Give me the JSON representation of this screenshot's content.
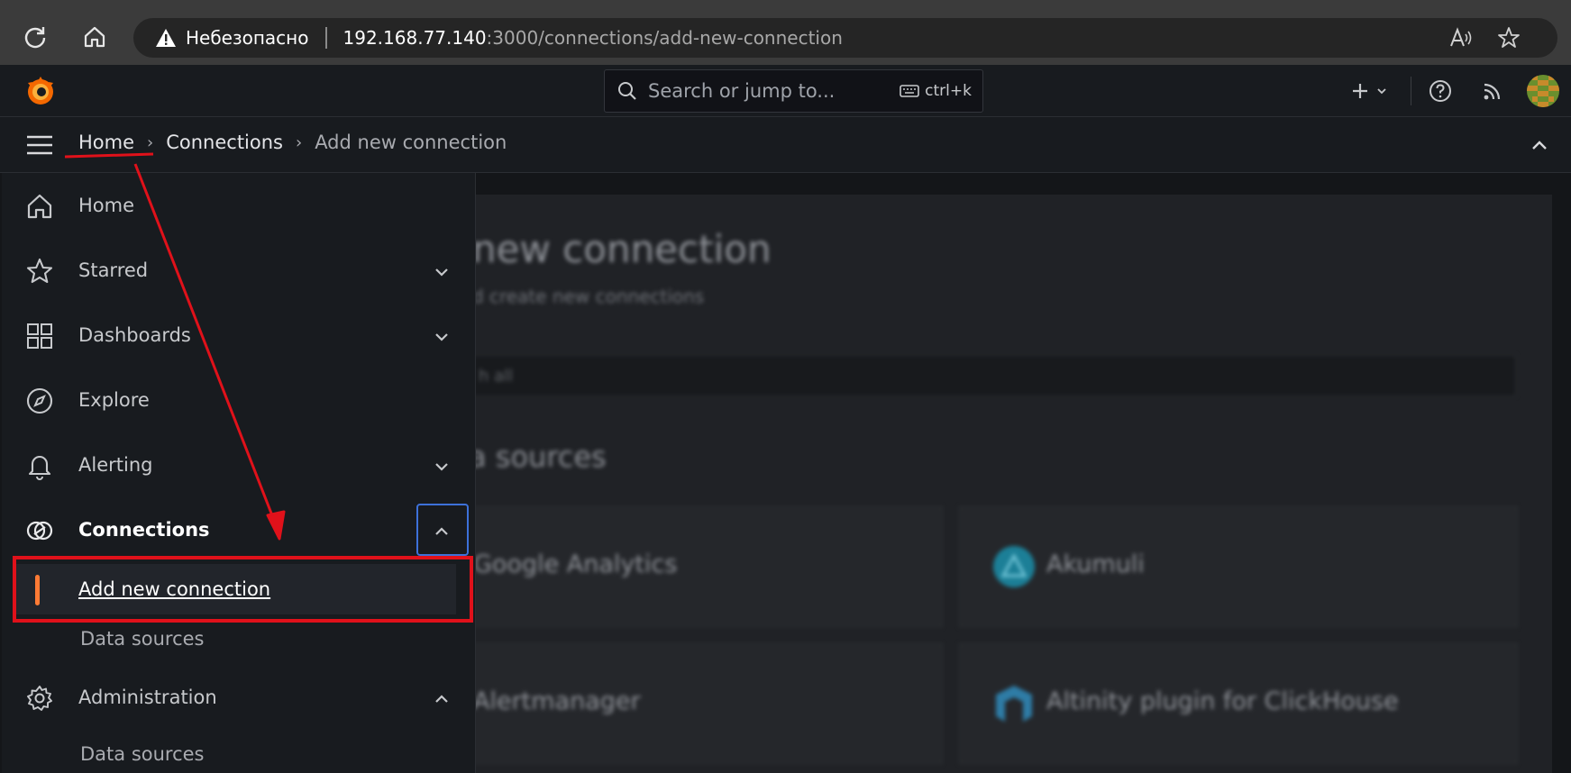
{
  "browser": {
    "insecure_label": "Небезопасно",
    "url_host": "192.168.77.140",
    "url_path": ":3000/connections/add-new-connection",
    "icons": [
      "reload-icon",
      "home-icon",
      "warning-icon",
      "read-aloud-icon",
      "favorite-star-icon"
    ]
  },
  "topbar": {
    "search_placeholder": "Search or jump to...",
    "shortcut": "ctrl+k",
    "icons": [
      "grafana-logo",
      "search-icon",
      "keyboard-icon",
      "plus-icon",
      "chevron-down-icon",
      "help-icon",
      "news-feed-icon",
      "avatar"
    ]
  },
  "breadcrumbs": {
    "items": [
      "Home",
      "Connections",
      "Add new connection"
    ],
    "separator": "›"
  },
  "sidebar": {
    "items": [
      {
        "label": "Home",
        "icon": "home-icon"
      },
      {
        "label": "Starred",
        "icon": "star-icon"
      },
      {
        "label": "Dashboards",
        "icon": "dashboards-grid-icon"
      },
      {
        "label": "Explore",
        "icon": "compass-icon"
      },
      {
        "label": "Alerting",
        "icon": "bell-icon"
      },
      {
        "label": "Connections",
        "icon": "connections-icon"
      },
      {
        "label": "Administration",
        "icon": "gear-icon"
      }
    ],
    "connections_children": [
      "Add new connection",
      "Data sources"
    ],
    "administration_children": [
      "Data sources"
    ]
  },
  "main": {
    "title": "new connection",
    "subtitle": "d create new connections",
    "search_placeholder": "h all",
    "section_heading": "a sources",
    "cards": [
      "Google Analytics",
      "Akumuli",
      "Alertmanager",
      "Altinity plugin for ClickHouse"
    ]
  },
  "colors": {
    "accent_orange": "#ff7b35",
    "annotation_red": "#e0111a",
    "focus_blue": "#3d71d9"
  }
}
